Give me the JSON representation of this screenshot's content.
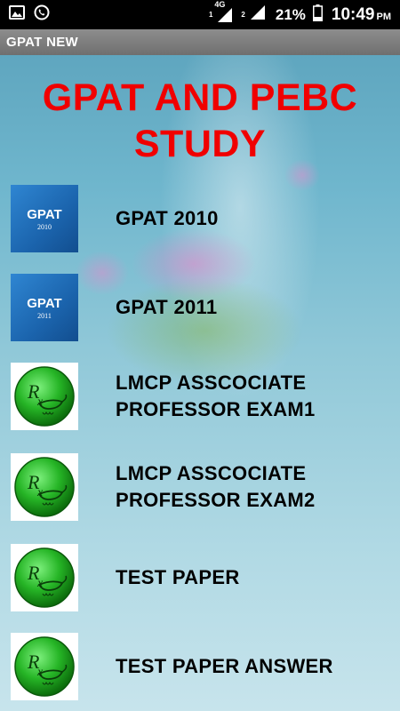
{
  "status_bar": {
    "network_label": "4G",
    "sim1": "1",
    "sim2": "2",
    "battery_percent": "21%",
    "time": "10:49",
    "ampm": "PM"
  },
  "action_bar": {
    "title": "GPAT NEW"
  },
  "hero_title_line1": "GPAT AND PEBC",
  "hero_title_line2": "STUDY",
  "items": [
    {
      "label": "GPAT 2010",
      "thumb_top": "GPAT",
      "thumb_bottom": "2010",
      "icon": "gpat-2010-icon"
    },
    {
      "label": "GPAT 2011",
      "thumb_top": "GPAT",
      "thumb_bottom": "2011",
      "icon": "gpat-2011-icon"
    },
    {
      "label_line1": "LMCP ASSCOCIATE",
      "label_line2": "PROFESSOR EXAM1",
      "icon": "rx-lamp-icon"
    },
    {
      "label_line1": "LMCP ASSCOCIATE",
      "label_line2": "PROFESSOR EXAM2",
      "icon": "rx-lamp-icon"
    },
    {
      "label": "TEST PAPER",
      "icon": "rx-lamp-icon"
    },
    {
      "label": "TEST PAPER ANSWER",
      "icon": "rx-lamp-icon"
    }
  ],
  "colors": {
    "title_red": "#f00000",
    "action_bar": "#7f7f7f",
    "rx_green": "#2ec02e"
  }
}
